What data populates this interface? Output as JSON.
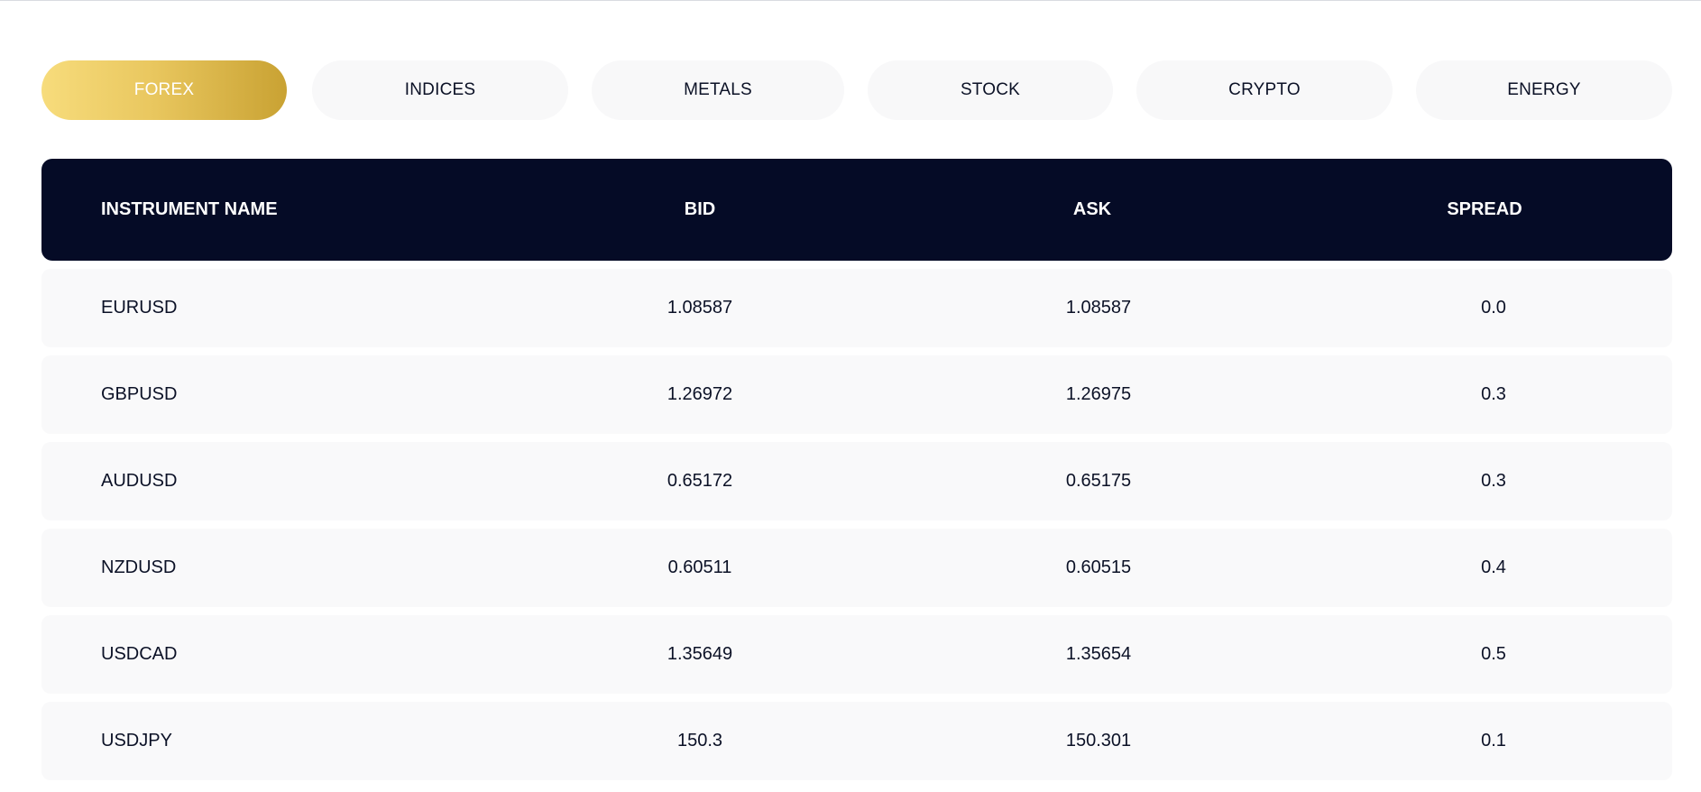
{
  "tabs": [
    {
      "label": "FOREX",
      "active": true
    },
    {
      "label": "INDICES",
      "active": false
    },
    {
      "label": "METALS",
      "active": false
    },
    {
      "label": "STOCK",
      "active": false
    },
    {
      "label": "CRYPTO",
      "active": false
    },
    {
      "label": "ENERGY",
      "active": false
    }
  ],
  "table": {
    "headers": {
      "name": "INSTRUMENT NAME",
      "bid": "BID",
      "ask": "ASK",
      "spread": "SPREAD"
    },
    "rows": [
      {
        "name": "EURUSD",
        "bid": "1.08587",
        "ask": "1.08587",
        "spread": "0.0"
      },
      {
        "name": "GBPUSD",
        "bid": "1.26972",
        "ask": "1.26975",
        "spread": "0.3"
      },
      {
        "name": "AUDUSD",
        "bid": "0.65172",
        "ask": "0.65175",
        "spread": "0.3"
      },
      {
        "name": "NZDUSD",
        "bid": "0.60511",
        "ask": "0.60515",
        "spread": "0.4"
      },
      {
        "name": "USDCAD",
        "bid": "1.35649",
        "ask": "1.35654",
        "spread": "0.5"
      },
      {
        "name": "USDJPY",
        "bid": "150.3",
        "ask": "150.301",
        "spread": "0.1"
      }
    ]
  },
  "colors": {
    "header_bg": "#050b26",
    "row_bg": "#f9f9fa",
    "tab_bg": "#f8f8f9",
    "active_tab_gradient_start": "#f7dc7c",
    "active_tab_gradient_end": "#c9a233",
    "text": "#0b1126"
  }
}
